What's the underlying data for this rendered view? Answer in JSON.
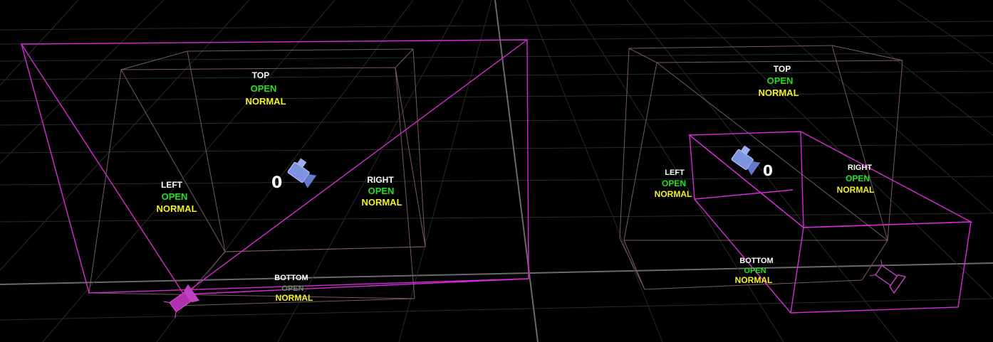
{
  "colors": {
    "background": "#000000",
    "grid": "#2a2a2a",
    "grid_axis": "#6a6a6a",
    "portal_frame": "#7a5a5a",
    "volume_outline": "#d82ad8",
    "camera_icon": "#7f94e0",
    "light_icon": "#b030b0",
    "side_name": "#ffffff",
    "state_open": "#22e022",
    "state_normal": "#f2f21e"
  },
  "rooms": [
    {
      "id": "room-left",
      "counter": "0",
      "camera_icon": "camera-icon",
      "light_icon": "spotlight-icon",
      "sides": [
        {
          "name": "TOP",
          "state": "OPEN",
          "mode": "NORMAL"
        },
        {
          "name": "LEFT",
          "state": "OPEN",
          "mode": "NORMAL"
        },
        {
          "name": "RIGHT",
          "state": "OPEN",
          "mode": "NORMAL"
        },
        {
          "name": "BOTTOM",
          "state": "OPEN",
          "mode": "NORMAL"
        }
      ]
    },
    {
      "id": "room-right",
      "counter": "0",
      "camera_icon": "camera-icon",
      "light_icon": "spotlight-icon",
      "sides": [
        {
          "name": "TOP",
          "state": "OPEN",
          "mode": "NORMAL"
        },
        {
          "name": "LEFT",
          "state": "OPEN",
          "mode": "NORMAL"
        },
        {
          "name": "RIGHT",
          "state": "OPEN",
          "mode": "NORMAL"
        },
        {
          "name": "BOTTOM",
          "state": "OPEN",
          "mode": "NORMAL"
        }
      ]
    }
  ]
}
